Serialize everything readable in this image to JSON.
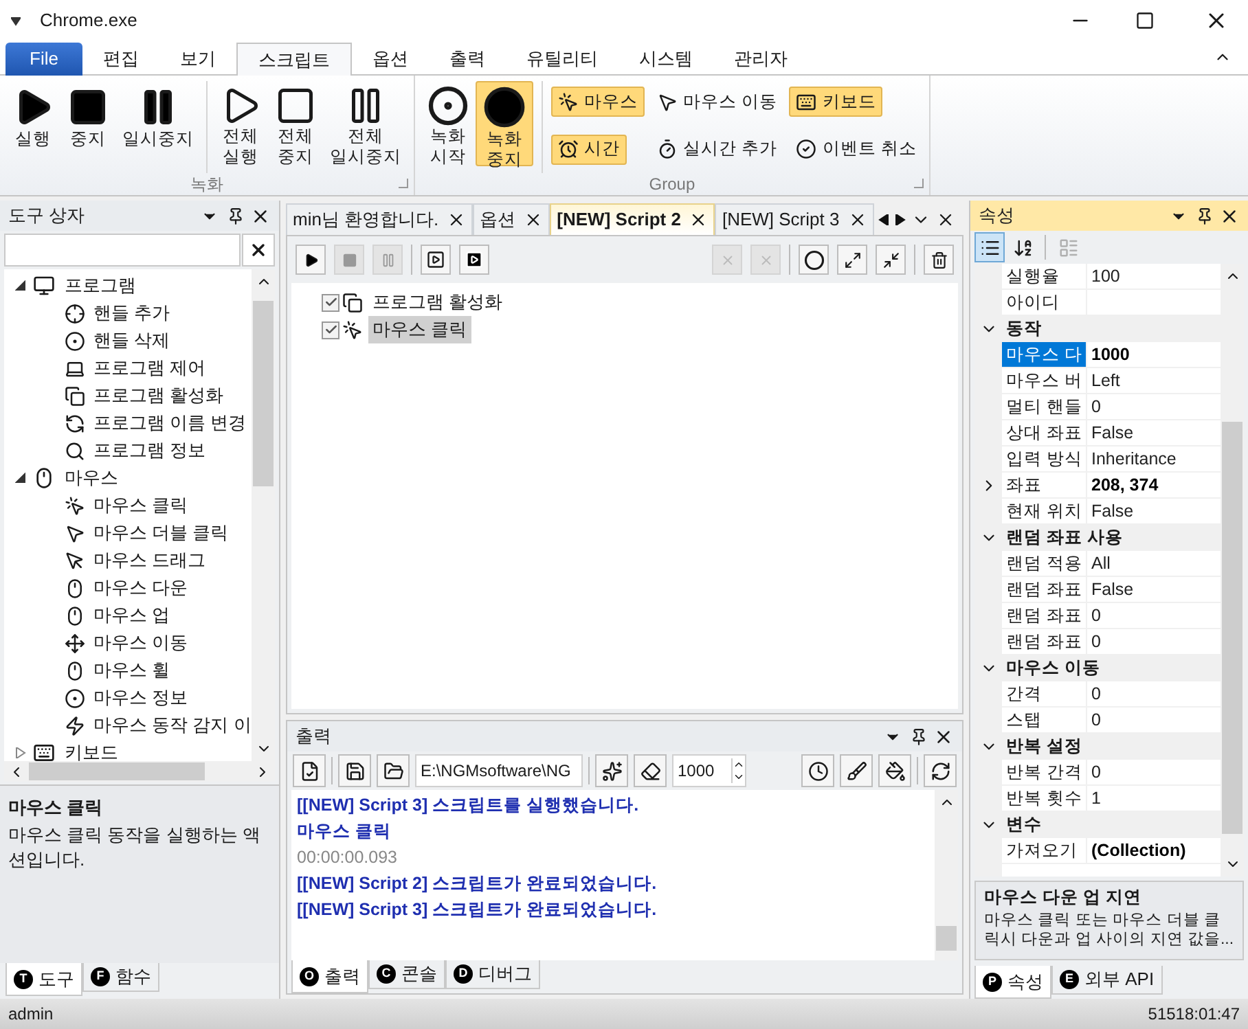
{
  "window": {
    "title": "Chrome.exe"
  },
  "menu": [
    {
      "label": "File",
      "kind": "file",
      "selected": false
    },
    {
      "label": "편집",
      "kind": "tab",
      "selected": false
    },
    {
      "label": "보기",
      "kind": "tab",
      "selected": false
    },
    {
      "label": "스크립트",
      "kind": "tab",
      "selected": true
    },
    {
      "label": "옵션",
      "kind": "tab",
      "selected": false
    },
    {
      "label": "출력",
      "kind": "tab",
      "selected": false
    },
    {
      "label": "유틸리티",
      "kind": "tab",
      "selected": false
    },
    {
      "label": "시스템",
      "kind": "tab",
      "selected": false
    },
    {
      "label": "관리자",
      "kind": "tab",
      "selected": false
    }
  ],
  "ribbon": {
    "groups": [
      {
        "label": "녹화",
        "sets": [
          [
            {
              "label": "실행",
              "selected": false
            },
            {
              "label": "중지",
              "selected": false
            },
            {
              "label": "일시중지",
              "selected": false
            }
          ],
          [
            {
              "label": "전체 실행",
              "selected": false
            },
            {
              "label": "전체 중지",
              "selected": false
            },
            {
              "label": "전체 일시중지",
              "selected": false
            }
          ]
        ]
      },
      {
        "label": "Group",
        "sets": [
          [
            {
              "label": "녹화 시작",
              "selected": false
            },
            {
              "label": "녹화 중지",
              "selected": true
            }
          ]
        ],
        "small_buttons": [
          {
            "label": "마우스",
            "selected": true
          },
          {
            "label": "마우스 이동",
            "selected": false
          },
          {
            "label": "키보드",
            "selected": true
          },
          {
            "label": "시간",
            "selected": true
          },
          {
            "label": "실시간 추가",
            "selected": false
          },
          {
            "label": "이벤트 취소",
            "selected": false
          }
        ]
      }
    ]
  },
  "toolbox": {
    "title": "도구 상자",
    "tree": [
      {
        "label": "프로그램",
        "expanded": true,
        "children": [
          {
            "label": "핸들 추가"
          },
          {
            "label": "핸들 삭제"
          },
          {
            "label": "프로그램 제어"
          },
          {
            "label": "프로그램 활성화"
          },
          {
            "label": "프로그램 이름 변경"
          },
          {
            "label": "프로그램 정보"
          }
        ]
      },
      {
        "label": "마우스",
        "expanded": true,
        "children": [
          {
            "label": "마우스 클릭"
          },
          {
            "label": "마우스 더블 클릭"
          },
          {
            "label": "마우스 드래그"
          },
          {
            "label": "마우스 다운"
          },
          {
            "label": "마우스 업"
          },
          {
            "label": "마우스 이동"
          },
          {
            "label": "마우스 휠"
          },
          {
            "label": "마우스 정보"
          },
          {
            "label": "마우스 동작 감지 이"
          }
        ]
      },
      {
        "label": "키보드",
        "expanded": false
      }
    ],
    "description": {
      "title": "마우스 클릭",
      "text": "마우스 클릭 동작을 실행하는 액션입니다."
    },
    "tabs": [
      {
        "badge": "T",
        "label": "도구",
        "selected": true
      },
      {
        "badge": "F",
        "label": "함수",
        "selected": false
      }
    ]
  },
  "documents": {
    "tabs": [
      {
        "label": "min님 환영합니다.",
        "selected": false
      },
      {
        "label": "옵션",
        "selected": false
      },
      {
        "label": "[NEW] Script 2",
        "selected": true
      },
      {
        "label": "[NEW] Script 3",
        "selected": false
      }
    ],
    "toolbar": [
      {
        "disabled": false
      },
      {
        "disabled": true
      },
      {
        "disabled": true
      },
      {
        "disabled": false
      },
      {
        "disabled": false
      },
      {
        "disabled": true
      },
      {
        "disabled": true
      },
      {
        "disabled": false
      },
      {
        "disabled": false
      },
      {
        "disabled": false
      },
      {
        "disabled": false
      }
    ],
    "script": [
      {
        "label": "프로그램 활성화",
        "checked": true,
        "selected": false
      },
      {
        "label": "마우스 클릭",
        "checked": true,
        "selected": true
      }
    ]
  },
  "output": {
    "title": "출력",
    "path": "E:\\NGMsoftware\\NG",
    "count": "1000",
    "lines": [
      {
        "text": "[[NEW] Script 3] 스크립트를 실행했습니다.",
        "kind": "message"
      },
      {
        "text": "마우스 클릭",
        "kind": "message"
      },
      {
        "text": "00:00:00.093",
        "kind": "time"
      },
      {
        "text": "[[NEW] Script 2] 스크립트가 완료되었습니다.",
        "kind": "message"
      },
      {
        "text": "[[NEW] Script 3] 스크립트가 완료되었습니다.",
        "kind": "message"
      }
    ],
    "tabs": [
      {
        "badge": "O",
        "label": "출력",
        "selected": true
      },
      {
        "badge": "C",
        "label": "콘솔",
        "selected": false
      },
      {
        "badge": "D",
        "label": "디버그",
        "selected": false
      }
    ]
  },
  "properties": {
    "title": "속성",
    "view_buttons": [
      {
        "selected": true,
        "disabled": false
      },
      {
        "selected": false,
        "disabled": false
      },
      {
        "selected": false,
        "disabled": true
      }
    ],
    "sections": [
      {
        "rows": [
          {
            "name": "실행율",
            "value": "100",
            "modified": false,
            "selected": false
          },
          {
            "name": "아이디",
            "selected": false
          }
        ]
      },
      {
        "title": "동작",
        "expanded": true,
        "rows": [
          {
            "name": "마우스 다",
            "value": "1000",
            "modified": true,
            "selected": true
          },
          {
            "name": "마우스 버",
            "value": "Left",
            "modified": false,
            "selected": false
          },
          {
            "name": "멀티 핸들",
            "value": "0",
            "modified": false,
            "selected": false
          },
          {
            "name": "상대 좌표",
            "value": "False",
            "modified": false,
            "selected": false
          },
          {
            "name": "입력 방식",
            "value": "Inheritance",
            "modified": false,
            "selected": false
          },
          {
            "name": "좌표",
            "value": "208, 374",
            "modified": true,
            "selected": false,
            "expanded": false
          },
          {
            "name": "현재 위치",
            "value": "False",
            "modified": false,
            "selected": false
          }
        ]
      },
      {
        "title": "랜덤 좌표 사용",
        "expanded": true,
        "rows": [
          {
            "name": "랜덤 적용",
            "value": "All",
            "modified": false,
            "selected": false
          },
          {
            "name": "랜덤 좌표",
            "value": "False",
            "modified": false,
            "selected": false
          },
          {
            "name": "랜덤 좌표",
            "value": "0",
            "modified": false,
            "selected": false
          },
          {
            "name": "랜덤 좌표",
            "value": "0",
            "modified": false,
            "selected": false
          }
        ]
      },
      {
        "title": "마우스 이동",
        "expanded": true,
        "rows": [
          {
            "name": "간격",
            "value": "0",
            "modified": false,
            "selected": false
          },
          {
            "name": "스탭",
            "value": "0",
            "modified": false,
            "selected": false
          }
        ]
      },
      {
        "title": "반복 설정",
        "expanded": true,
        "rows": [
          {
            "name": "반복 간격",
            "value": "0",
            "modified": false,
            "selected": false
          },
          {
            "name": "반복 횟수",
            "value": "1",
            "modified": false,
            "selected": false
          }
        ]
      },
      {
        "title": "변수",
        "expanded": true,
        "rows": [
          {
            "name": "가져오기",
            "value": "(Collection)",
            "modified": true,
            "selected": false
          }
        ]
      }
    ],
    "description": {
      "title": "마우스 다운 업 지연",
      "text": "마우스 클릭 또는 마우스 더블 클릭시 다운과 업 사이의 지연 값을..."
    },
    "tabs": [
      {
        "badge": "P",
        "label": "속성",
        "selected": true
      },
      {
        "badge": "E",
        "label": "외부 API",
        "selected": false
      }
    ]
  },
  "status_bar": {
    "user": "admin",
    "time": "51518:01:47"
  }
}
